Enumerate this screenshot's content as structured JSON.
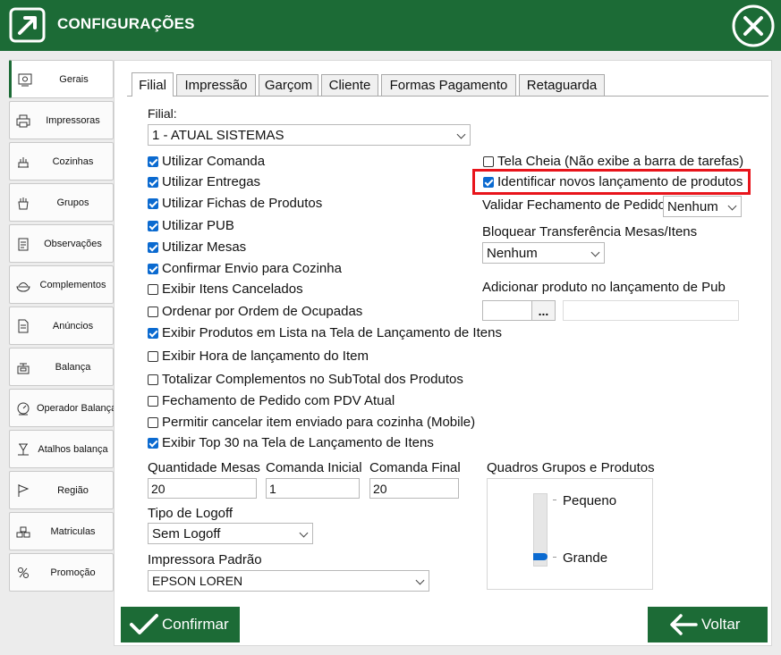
{
  "window": {
    "title": "CONFIGURAÇÕES"
  },
  "sidebar": {
    "items": [
      {
        "label": "Gerais",
        "icon": "gear-icon"
      },
      {
        "label": "Impressoras",
        "icon": "printer-icon"
      },
      {
        "label": "Cozinhas",
        "icon": "kitchen-icon"
      },
      {
        "label": "Grupos",
        "icon": "groups-icon"
      },
      {
        "label": "Observações",
        "icon": "notes-icon"
      },
      {
        "label": "Complementos",
        "icon": "complements-icon"
      },
      {
        "label": "Anúncios",
        "icon": "document-icon"
      },
      {
        "label": "Balança",
        "icon": "scale-icon"
      },
      {
        "label": "Operador Balança",
        "icon": "scale-operator-icon"
      },
      {
        "label": "Atalhos balança",
        "icon": "scale-shortcut-icon"
      },
      {
        "label": "Região",
        "icon": "flag-icon"
      },
      {
        "label": "Matriculas",
        "icon": "registrations-icon"
      },
      {
        "label": "Promoção",
        "icon": "promotion-icon"
      }
    ]
  },
  "tabs": [
    "Filial",
    "Impressão",
    "Garçom",
    "Cliente",
    "Formas Pagamento",
    "Retaguarda"
  ],
  "filial": {
    "label": "Filial:",
    "value": "1 - ATUAL SISTEMAS",
    "checkboxes": [
      {
        "label": "Utilizar Comanda",
        "checked": true
      },
      {
        "label": "Utilizar Entregas",
        "checked": true
      },
      {
        "label": "Utilizar Fichas de Produtos",
        "checked": true
      },
      {
        "label": "Utilizar PUB",
        "checked": true
      },
      {
        "label": "Utilizar Mesas",
        "checked": true
      },
      {
        "label": "Confirmar Envio para Cozinha",
        "checked": true
      },
      {
        "label": "Exibir Itens Cancelados",
        "checked": false
      },
      {
        "label": "Ordenar por Ordem de Ocupadas",
        "checked": false
      },
      {
        "label": "Exibir Produtos em Lista na Tela de Lançamento de Itens",
        "checked": true
      },
      {
        "label": "Exibir Hora de lançamento do Item",
        "checked": false
      },
      {
        "label": "Totalizar Complementos no SubTotal dos Produtos",
        "checked": false
      },
      {
        "label": "Fechamento de Pedido com PDV Atual",
        "checked": false
      },
      {
        "label": "Permitir cancelar item enviado para cozinha (Mobile)",
        "checked": false
      },
      {
        "label": "Exibir Top 30 na Tela de Lançamento de Itens",
        "checked": true
      }
    ],
    "right": {
      "tela_cheia": {
        "label": "Tela Cheia (Não exibe a barra de tarefas)",
        "checked": false
      },
      "identificar": {
        "label": "Identificar novos lançamento de produtos",
        "checked": true
      },
      "validar_label": "Validar Fechamento de Pedido",
      "validar_value": "Nenhum",
      "bloquear_label": "Bloquear Transferência Mesas/Itens",
      "bloquear_value": "Nenhum",
      "adicionar_label": "Adicionar produto no lançamento de Pub",
      "browse_label": "...",
      "adicionar_code": "",
      "adicionar_name": ""
    },
    "quantidade_mesas": {
      "label": "Quantidade Mesas",
      "value": "20"
    },
    "comanda_inicial": {
      "label": "Comanda Inicial",
      "value": "1"
    },
    "comanda_final": {
      "label": "Comanda Final",
      "value": "20"
    },
    "tipo_logoff": {
      "label": "Tipo de Logoff",
      "value": "Sem Logoff"
    },
    "impressora_padrao": {
      "label": "Impressora Padrão",
      "value": "EPSON LOREN"
    },
    "quadros": {
      "label": "Quadros Grupos e Produtos",
      "min_label": "Pequeno",
      "max_label": "Grande",
      "selected": "Grande"
    }
  },
  "footer": {
    "confirm_label": "Confirmar",
    "back_label": "Voltar"
  },
  "colors": {
    "primary_green": "#1c6b36",
    "highlight_red": "#e8141b",
    "check_blue": "#0b6ad0"
  }
}
